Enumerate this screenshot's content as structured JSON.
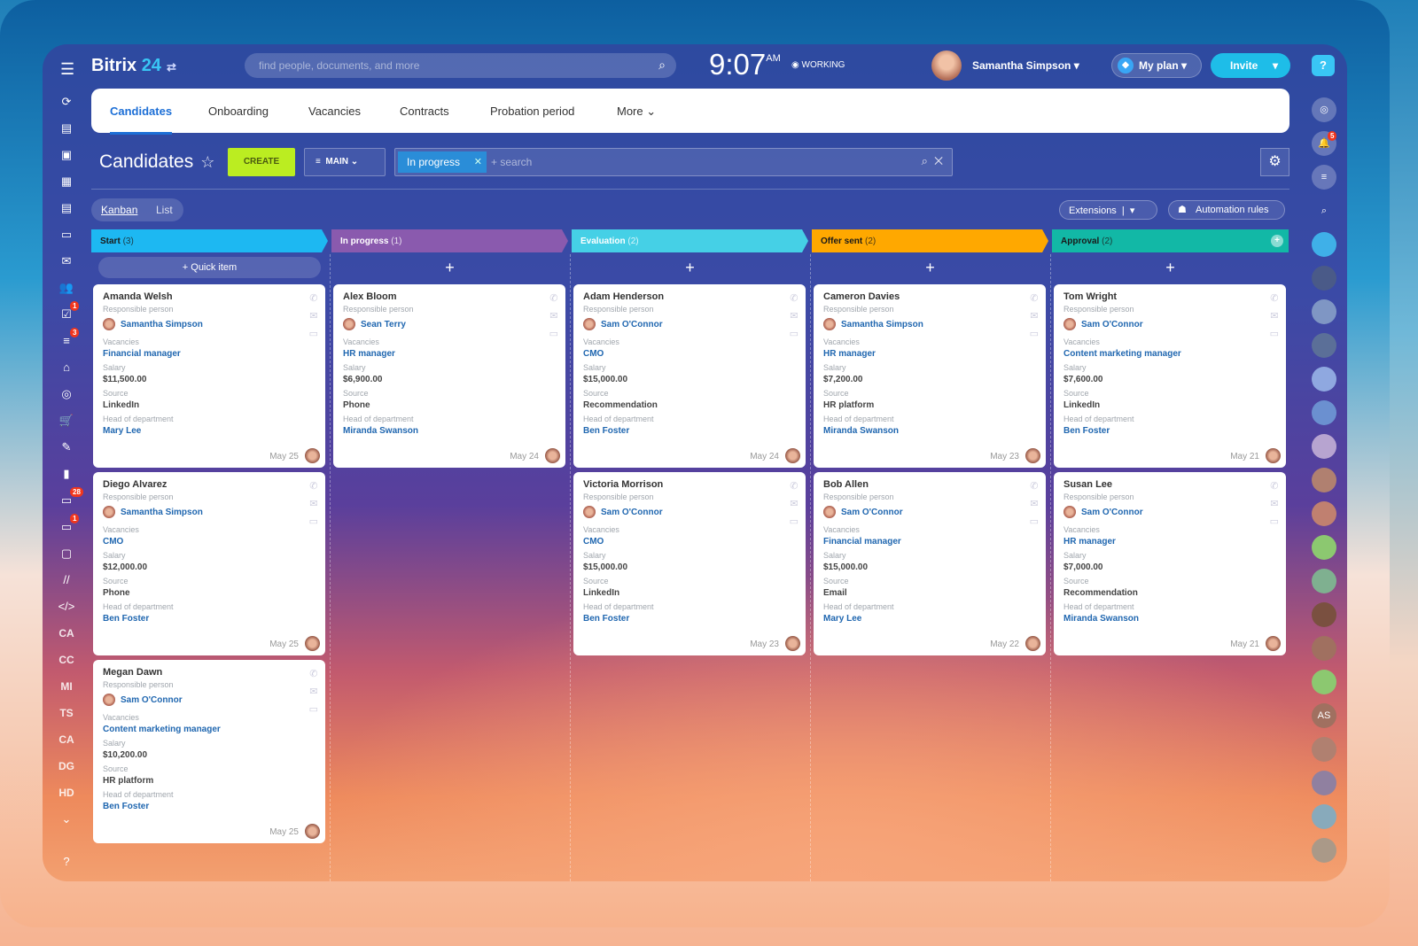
{
  "header": {
    "logo_text": "Bitrix",
    "logo_num": "24",
    "search_placeholder": "find people, documents, and more",
    "time": "9:07",
    "ampm": "AM",
    "status": "WORKING",
    "user": "Samantha Simpson",
    "my_plan": "My plan",
    "invite": "Invite",
    "help": "?"
  },
  "tabs": [
    {
      "label": "Candidates"
    },
    {
      "label": "Onboarding"
    },
    {
      "label": "Vacancies"
    },
    {
      "label": "Contracts"
    },
    {
      "label": "Probation period"
    },
    {
      "label": "More ⌄"
    }
  ],
  "toolbar": {
    "title": "Candidates",
    "create": "CREATE",
    "filter_preset": "MAIN",
    "filter_chip": "In progress",
    "search_placeholder": "+ search",
    "view_kanban": "Kanban",
    "view_list": "List",
    "extensions": "Extensions",
    "automation": "Automation rules",
    "quick_item": "+ Quick item"
  },
  "left_sidebar": [
    {
      "icon": "⟳"
    },
    {
      "icon": "▤"
    },
    {
      "icon": "▣"
    },
    {
      "icon": "▦"
    },
    {
      "icon": "▤"
    },
    {
      "icon": "▭"
    },
    {
      "icon": "✉"
    },
    {
      "icon": "👥"
    },
    {
      "icon": "☑",
      "badge": "1"
    },
    {
      "icon": "≡",
      "badge": "3"
    },
    {
      "icon": "⌂"
    },
    {
      "icon": "◎"
    },
    {
      "icon": "🛒"
    },
    {
      "icon": "✎"
    },
    {
      "icon": "▮"
    },
    {
      "icon": "▭",
      "badge": "28"
    },
    {
      "icon": "▭",
      "badge": "1"
    },
    {
      "icon": "▢"
    },
    {
      "icon": "//"
    },
    {
      "icon": "</>"
    },
    {
      "text": "CA"
    },
    {
      "text": "CC"
    },
    {
      "text": "MI"
    },
    {
      "text": "TS"
    },
    {
      "text": "CA"
    },
    {
      "text": "DG"
    },
    {
      "text": "HD"
    },
    {
      "icon": "⌄"
    },
    {
      "icon": "?"
    }
  ],
  "right_sidebar": [
    {
      "icon": "◎"
    },
    {
      "icon": "🔔",
      "badge": "5"
    },
    {
      "icon": "≡"
    },
    {
      "icon": "⌕"
    },
    {
      "text": ""
    },
    {
      "text": ""
    },
    {
      "text": ""
    },
    {
      "text": ""
    },
    {
      "text": ""
    },
    {
      "text": ""
    },
    {
      "text": ""
    },
    {
      "text": ""
    },
    {
      "text": ""
    },
    {
      "text": ""
    },
    {
      "text": ""
    },
    {
      "text": ""
    },
    {
      "text": ""
    },
    {
      "text": ""
    },
    {
      "text": "AS"
    },
    {
      "text": ""
    },
    {
      "text": ""
    },
    {
      "text": ""
    },
    {
      "text": ""
    }
  ],
  "labels": {
    "responsible": "Responsible person",
    "vacancies": "Vacancies",
    "salary": "Salary",
    "source": "Source",
    "head": "Head of department"
  },
  "columns": [
    {
      "title": "Start",
      "count": "(3)",
      "color": "#1db8f2",
      "text_color": "#1a1a1a",
      "cards": [
        {
          "name": "Amanda Welsh",
          "responsible": "Samantha Simpson",
          "vacancy": "Financial manager",
          "salary": "$11,500.00",
          "source": "LinkedIn",
          "head": "Mary Lee",
          "date": "May 25"
        },
        {
          "name": "Diego Alvarez",
          "responsible": "Samantha Simpson",
          "vacancy": "CMO",
          "salary": "$12,000.00",
          "source": "Phone",
          "head": "Ben Foster",
          "date": "May 25"
        },
        {
          "name": "Megan Dawn",
          "responsible": "Sam O'Connor",
          "vacancy": "Content marketing manager",
          "salary": "$10,200.00",
          "source": "HR platform",
          "head": "Ben Foster",
          "date": "May 25"
        }
      ]
    },
    {
      "title": "In progress",
      "count": "(1)",
      "color": "#8a5aae",
      "text_color": "#ffffff",
      "cards": [
        {
          "name": "Alex Bloom",
          "responsible": "Sean Terry",
          "vacancy": "HR manager",
          "salary": "$6,900.00",
          "source": "Phone",
          "head": "Miranda Swanson",
          "date": "May 24"
        }
      ]
    },
    {
      "title": "Evaluation",
      "count": "(2)",
      "color": "#45d0e6",
      "text_color": "#ffffff",
      "cards": [
        {
          "name": "Adam Henderson",
          "responsible": "Sam O'Connor",
          "vacancy": "CMO",
          "salary": "$15,000.00",
          "source": "Recommendation",
          "head": "Ben Foster",
          "date": "May 24"
        },
        {
          "name": "Victoria Morrison",
          "responsible": "Sam O'Connor",
          "vacancy": "CMO",
          "salary": "$15,000.00",
          "source": "LinkedIn",
          "head": "Ben Foster",
          "date": "May 23"
        }
      ]
    },
    {
      "title": "Offer sent",
      "count": "(2)",
      "color": "#ffa800",
      "text_color": "#1a1a1a",
      "cards": [
        {
          "name": "Cameron Davies",
          "responsible": "Samantha Simpson",
          "vacancy": "HR manager",
          "salary": "$7,200.00",
          "source": "HR platform",
          "head": "Miranda Swanson",
          "date": "May 23"
        },
        {
          "name": "Bob Allen",
          "responsible": "Sam O'Connor",
          "vacancy": "Financial manager",
          "salary": "$15,000.00",
          "source": "Email",
          "head": "Mary Lee",
          "date": "May 22"
        }
      ]
    },
    {
      "title": "Approval",
      "count": "(2)",
      "color": "#12b8a6",
      "text_color": "#1a1a1a",
      "cards": [
        {
          "name": "Tom Wright",
          "responsible": "Sam O'Connor",
          "vacancy": "Content marketing manager",
          "salary": "$7,600.00",
          "source": "LinkedIn",
          "head": "Ben Foster",
          "date": "May 21"
        },
        {
          "name": "Susan Lee",
          "responsible": "Sam O'Connor",
          "vacancy": "HR manager",
          "salary": "$7,000.00",
          "source": "Recommendation",
          "head": "Miranda Swanson",
          "date": "May 21"
        }
      ]
    }
  ]
}
